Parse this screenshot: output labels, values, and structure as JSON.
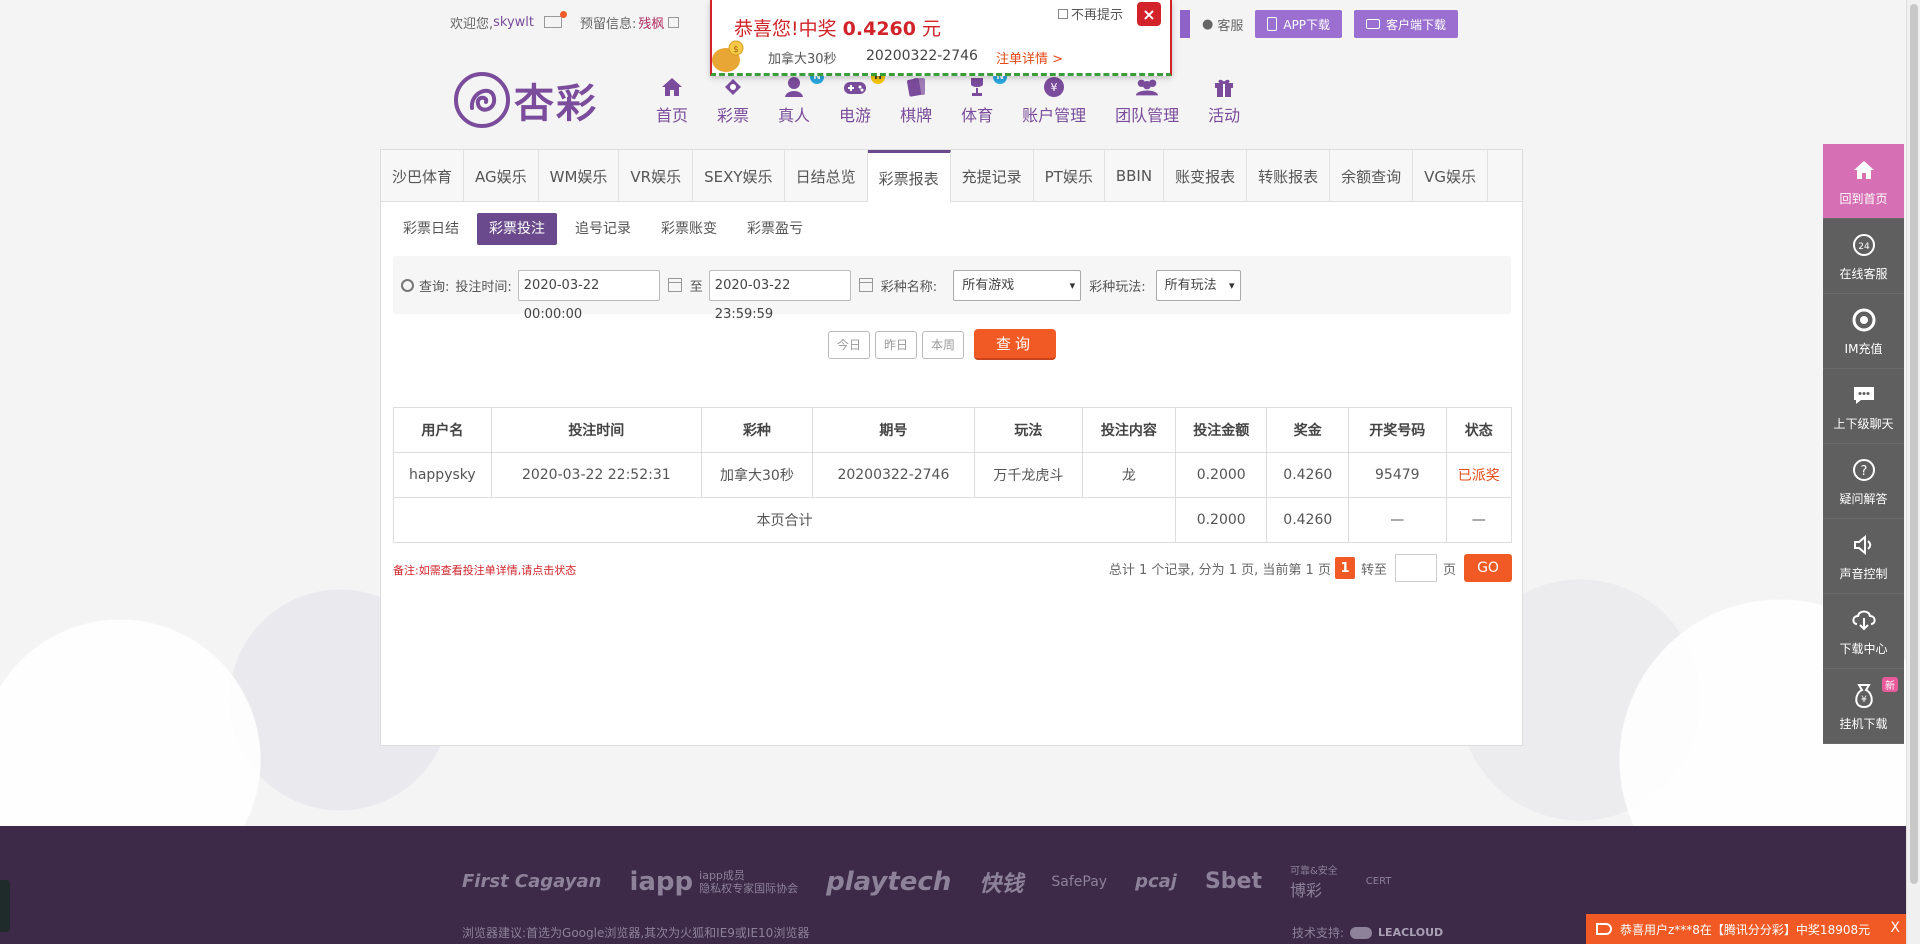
{
  "topbar": {
    "welcome": "欢迎您,",
    "username": "skywlt",
    "reserve_label": "预留信息:",
    "reserve_value": "残枫"
  },
  "top_right": {
    "service": "客服",
    "app_download": "APP下载",
    "client_download": "客户端下载"
  },
  "brand": {
    "name": "杏彩"
  },
  "nav": [
    {
      "label": "首页",
      "icon": "home-icon",
      "badge": ""
    },
    {
      "label": "彩票",
      "icon": "lottery-icon",
      "badge": ""
    },
    {
      "label": "真人",
      "icon": "live-dealer-icon",
      "badge": "N"
    },
    {
      "label": "电游",
      "icon": "gamepad-icon",
      "badge": "H"
    },
    {
      "label": "棋牌",
      "icon": "cards-icon",
      "badge": ""
    },
    {
      "label": "体育",
      "icon": "trophy-icon",
      "badge": "N"
    },
    {
      "label": "账户管理",
      "icon": "account-icon",
      "badge": ""
    },
    {
      "label": "团队管理",
      "icon": "team-icon",
      "badge": ""
    },
    {
      "label": "活动",
      "icon": "gift-icon",
      "badge": ""
    }
  ],
  "popup": {
    "title_prefix": "恭喜您!中奖",
    "amount": "0.4260",
    "unit": "元",
    "no_show": "不再提示",
    "close": "×",
    "game": "加拿大30秒",
    "issue": "20200322-2746",
    "detail_link": "注单详情 >"
  },
  "tabs": [
    "沙巴体育",
    "AG娱乐",
    "WM娱乐",
    "VR娱乐",
    "SEXY娱乐",
    "日结总览",
    "彩票报表",
    "充提记录",
    "PT娱乐",
    "BBIN",
    "账变报表",
    "转账报表",
    "余额查询",
    "VG娱乐"
  ],
  "active_tab": "彩票报表",
  "subtabs": [
    "彩票日结",
    "彩票投注",
    "追号记录",
    "彩票账变",
    "彩票盈亏"
  ],
  "active_subtab": "彩票投注",
  "filter": {
    "query_label": "查询:",
    "time_label": "投注时间:",
    "start": "2020-03-22 00:00:00",
    "to": "至",
    "end": "2020-03-22 23:59:59",
    "game_label": "彩种名称:",
    "game_value": "所有游戏",
    "play_label": "彩种玩法:",
    "play_value": "所有玩法"
  },
  "quick": {
    "today": "今日",
    "yesterday": "昨日",
    "week": "本周",
    "search": "查询"
  },
  "table": {
    "headers": [
      "用户名",
      "投注时间",
      "彩种",
      "期号",
      "玩法",
      "投注内容",
      "投注金额",
      "奖金",
      "开奖号码",
      "状态"
    ],
    "rows": [
      [
        "happysky",
        "2020-03-22 22:52:31",
        "加拿大30秒",
        "20200322-2746",
        "万千龙虎斗",
        "龙",
        "0.2000",
        "0.4260",
        "95479",
        "已派奖"
      ]
    ],
    "total_label": "本页合计",
    "total_amount": "0.2000",
    "total_bonus": "0.4260",
    "total_dash1": "—",
    "total_dash2": "—"
  },
  "note": "备注:如需查看投注单详情,请点击状态",
  "pager": {
    "summary": "总计 1 个记录, 分为 1 页, 当前第 1 页",
    "current": "1",
    "goto": "转至",
    "page": "页",
    "go": "GO"
  },
  "sidebar": [
    {
      "label": "回到首页",
      "icon": "home-icon",
      "badge": ""
    },
    {
      "label": "在线客服",
      "icon": "support-24-icon",
      "badge": ""
    },
    {
      "label": "IM充值",
      "icon": "recharge-icon",
      "badge": ""
    },
    {
      "label": "上下级聊天",
      "icon": "chat-icon",
      "badge": ""
    },
    {
      "label": "疑问解答",
      "icon": "help-icon",
      "badge": ""
    },
    {
      "label": "声音控制",
      "icon": "sound-icon",
      "badge": ""
    },
    {
      "label": "下载中心",
      "icon": "cloud-download-icon",
      "badge": ""
    },
    {
      "label": "挂机下载",
      "icon": "money-bag-icon",
      "badge": "新"
    }
  ],
  "footer": {
    "partners": [
      "First Cagayan",
      "iapp",
      "iapp成员",
      "隐私权专家国际协会",
      "playtech",
      "快钱",
      "SafePay",
      "pcaj",
      "Sbet",
      "可靠&安全",
      "博彩",
      "CERT"
    ],
    "advice": "浏览器建议:首选为Google浏览器,其次为火狐和IE9或IE10浏览器",
    "tech_label": "技术支持:",
    "tech_name": "LEACLOUD"
  },
  "ticker": {
    "text": "恭喜用户z***8在【腾讯分分彩】中奖18908元",
    "close": "X"
  },
  "colors": {
    "purple": "#7a4c9b",
    "accent": "#f15a24",
    "popup_red": "#d2232a",
    "sidebar": "#5f5f5f",
    "sidebar_home": "#d66fb3",
    "footer": "#3c2a48"
  }
}
